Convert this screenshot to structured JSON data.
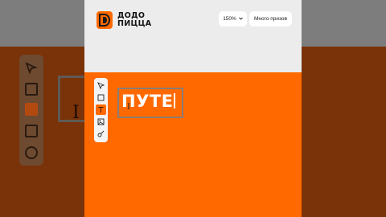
{
  "brand": {
    "line1": "ДОДО",
    "line2": "ПИЦЦА"
  },
  "header": {
    "zoom_label": "150%",
    "prizes_label": "Много призов"
  },
  "toolbar": {
    "tools": [
      {
        "icon": "pointer-icon"
      },
      {
        "icon": "rectangle-icon"
      },
      {
        "icon": "text-icon",
        "active": true
      },
      {
        "icon": "image-icon"
      },
      {
        "icon": "brush-icon"
      }
    ]
  },
  "canvas": {
    "text": "ПУТЕ"
  },
  "colors": {
    "accent": "#ff6900",
    "header_bg": "#ececec",
    "backdrop": "#7a3208"
  }
}
